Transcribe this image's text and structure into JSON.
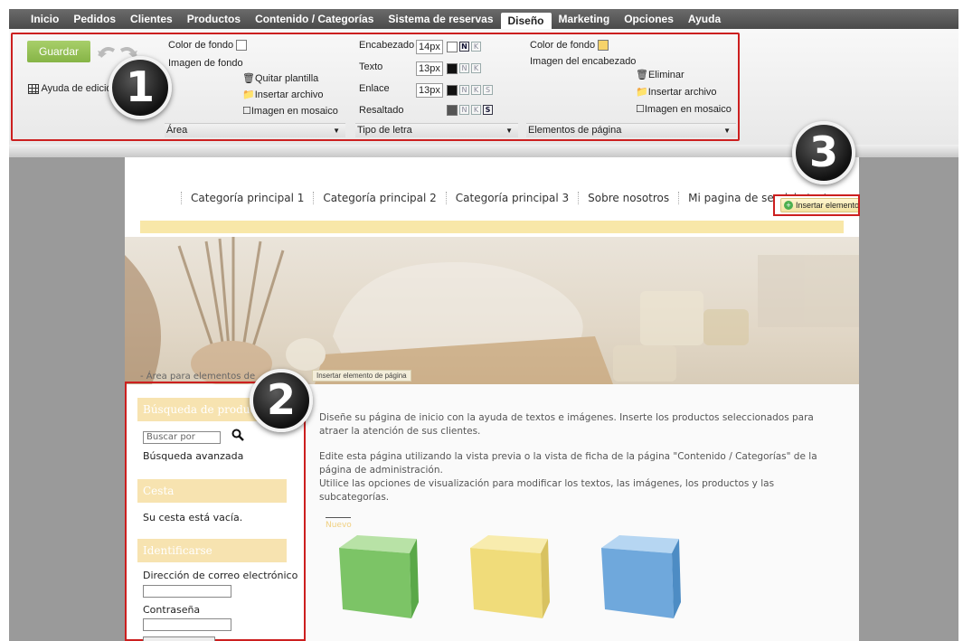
{
  "topnav": {
    "items": [
      "Inicio",
      "Pedidos",
      "Clientes",
      "Productos",
      "Contenido / Categorías",
      "Sistema de reservas",
      "Diseño",
      "Marketing",
      "Opciones",
      "Ayuda"
    ],
    "active": "Diseño"
  },
  "ribbon": {
    "save_label": "Guardar",
    "help_label": "Ayuda de edición",
    "area": {
      "bg_color_label": "Color de fondo",
      "bg_image_label": "Imagen de fondo",
      "remove_template": "Quitar plantilla",
      "insert_file": "Insertar archivo",
      "tile_image": "Imagen en mosaico",
      "section_label": "Área"
    },
    "font": {
      "heading_label": "Encabezado",
      "heading_size": "14px",
      "text_label": "Texto",
      "text_size": "13px",
      "link_label": "Enlace",
      "link_size": "13px",
      "highlight_label": "Resaltado",
      "section_label": "Tipo de letra",
      "bold": "N",
      "italic": "K",
      "underline": "S"
    },
    "page_elements": {
      "bg_color_label": "Color de fondo",
      "header_image_label": "Imagen del encabezado",
      "delete": "Eliminar",
      "insert_file": "Insertar archivo",
      "tile_image": "Imagen en mosaico",
      "section_label": "Elementos de página"
    }
  },
  "badges": [
    "1",
    "2",
    "3"
  ],
  "page": {
    "categories": [
      "Categoría principal 1",
      "Categoría principal 2",
      "Categoría principal 3",
      "Sobre nosotros",
      "Mi pagina de servicio test"
    ],
    "insert_element": "Insertar elemento",
    "area_label": "- Área para elementos de",
    "insert_page_element": "Insertar elemento de página",
    "sidebar": {
      "search_title": "Búsqueda de productos",
      "search_placeholder": "Buscar por",
      "advanced_search": "Búsqueda avanzada",
      "cart_title": "Cesta",
      "cart_empty": "Su cesta está vacía.",
      "login_title": "Identificarse",
      "email_label": "Dirección de correo electrónico",
      "password_label": "Contraseña"
    },
    "main": {
      "p1": "Diseñe su página de inicio con la ayuda de textos e imágenes. Inserte los productos seleccionados para atraer la atención de sus clientes.",
      "p2": "Edite esta página utilizando la vista previa o la vista de ficha de la página \"Contenido / Categorías\" de la página de administración.",
      "p3": "Utilice las opciones de visualización para modificar los textos, las imágenes, los productos y las subcategorías.",
      "new_label": "Nuevo"
    }
  },
  "colors": {
    "accent_red": "#cc1f1f",
    "save_green": "#86b446",
    "sidebar_head": "#f7e3b0",
    "cube_green": "#7cc466",
    "cube_yellow": "#f0dc7a",
    "cube_blue": "#6fa8dc"
  }
}
